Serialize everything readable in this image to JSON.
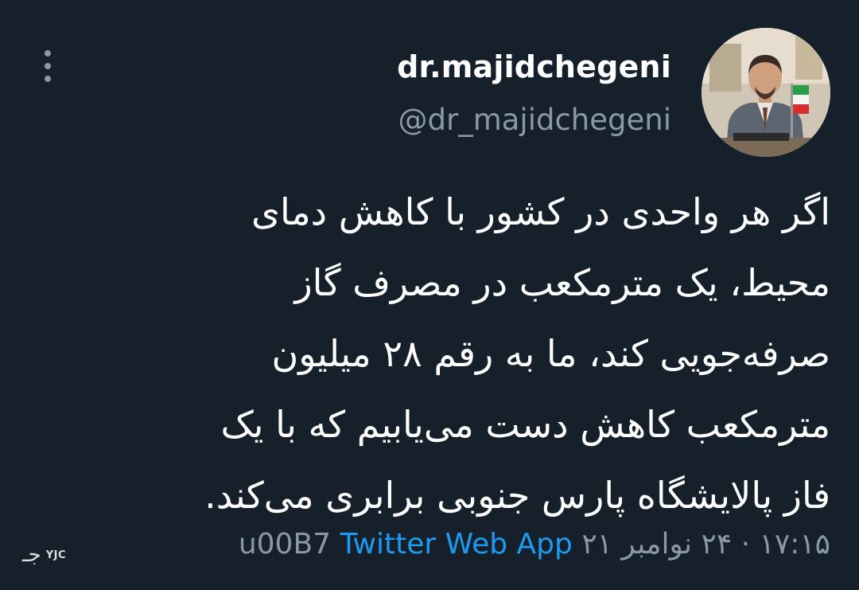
{
  "tweet": {
    "author": {
      "display_name": "dr.majidchegeni",
      "handle": "@dr_majidchegeni"
    },
    "text_lines": [
      "اگر هر واحدی در کشور با کاهش دمای",
      "محیط، یک مترمکعب در مصرف گاز",
      "صرفه‌جویی کند، ما به رقم ۲۸ میلیون",
      "مترمکعب کاهش دست می‌یابیم که با یک",
      "فاز پالایشگاه پارس جنوبی برابری می‌کند."
    ],
    "timestamp": "۱۷:۱۵ · ۲۴ نوامبر ۲۱",
    "separator": "u00B7",
    "source": "Twitter Web App"
  },
  "watermark": {
    "glyph": "جـ",
    "text": "YJC"
  },
  "colors": {
    "background": "#15202b",
    "primary_text": "#ffffff",
    "secondary_text": "#8b98a5",
    "link": "#1d9bf0"
  },
  "icons": {
    "more": "more-vertical-icon"
  }
}
